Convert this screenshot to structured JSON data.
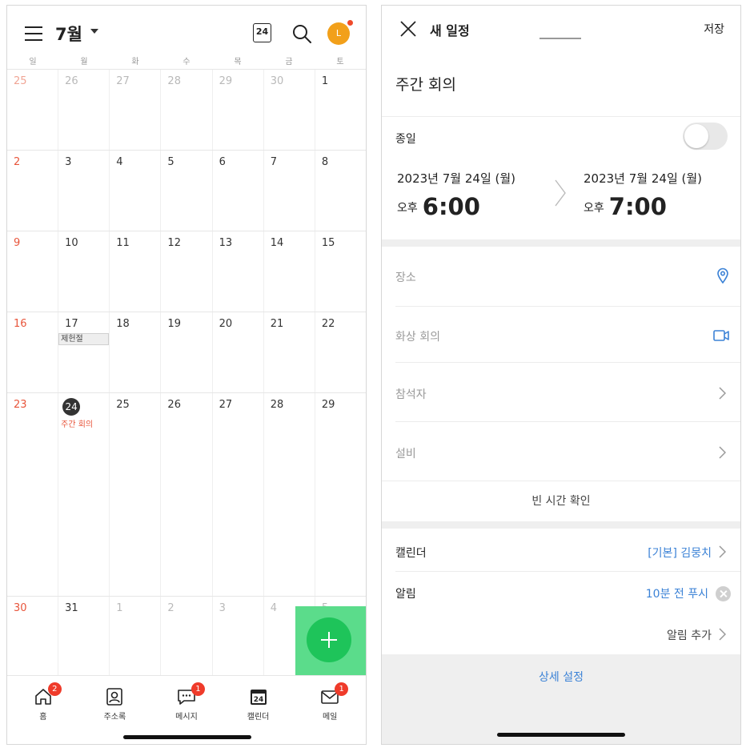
{
  "calendar": {
    "month_title": "7월",
    "today_icon_text": "24",
    "avatar_initial": "L",
    "weekdays": [
      "일",
      "월",
      "화",
      "수",
      "목",
      "금",
      "토"
    ],
    "weeks": [
      [
        "25",
        "26",
        "27",
        "28",
        "29",
        "30",
        "1"
      ],
      [
        "2",
        "3",
        "4",
        "5",
        "6",
        "7",
        "8"
      ],
      [
        "9",
        "10",
        "11",
        "12",
        "13",
        "14",
        "15"
      ],
      [
        "16",
        "17",
        "18",
        "19",
        "20",
        "21",
        "22"
      ],
      [
        "23",
        "24",
        "25",
        "26",
        "27",
        "28",
        "29"
      ],
      [
        "30",
        "31",
        "1",
        "2",
        "3",
        "4",
        "5"
      ]
    ],
    "holiday": "제헌절",
    "event": "주간 회의",
    "tabs": [
      {
        "label": "홈",
        "badge": "2",
        "icon": "home-icon"
      },
      {
        "label": "주소록",
        "badge": "",
        "icon": "contacts-icon"
      },
      {
        "label": "메시지",
        "badge": "1",
        "icon": "message-icon"
      },
      {
        "label": "캘린더",
        "badge": "",
        "icon": "calendar-icon",
        "icon_text": "24"
      },
      {
        "label": "메일",
        "badge": "1",
        "icon": "mail-icon"
      }
    ]
  },
  "new_event": {
    "header_title": "새 일정",
    "save_label": "저장",
    "event_name": "주간 회의",
    "allday_label": "종일",
    "allday_on": false,
    "start": {
      "date": "2023년 7월 24일 (월)",
      "ampm": "오후",
      "time": "6:00"
    },
    "end": {
      "date": "2023년 7월 24일 (월)",
      "ampm": "오후",
      "time": "7:00"
    },
    "location_placeholder": "장소",
    "video_placeholder": "화상 회의",
    "attendees_placeholder": "참석자",
    "equipment_placeholder": "설비",
    "free_time_label": "빈 시간 확인",
    "calendar_label": "캘린더",
    "calendar_value": "[기본] 김뭉치",
    "alarm_label": "알림",
    "alarm_value": "10분 전 푸시",
    "add_alarm_label": "알림 추가",
    "detail_settings_label": "상세 설정",
    "accent_color": "#3b82d6",
    "holiday_color": "#e8553b",
    "fab_color": "#1ec45a"
  }
}
